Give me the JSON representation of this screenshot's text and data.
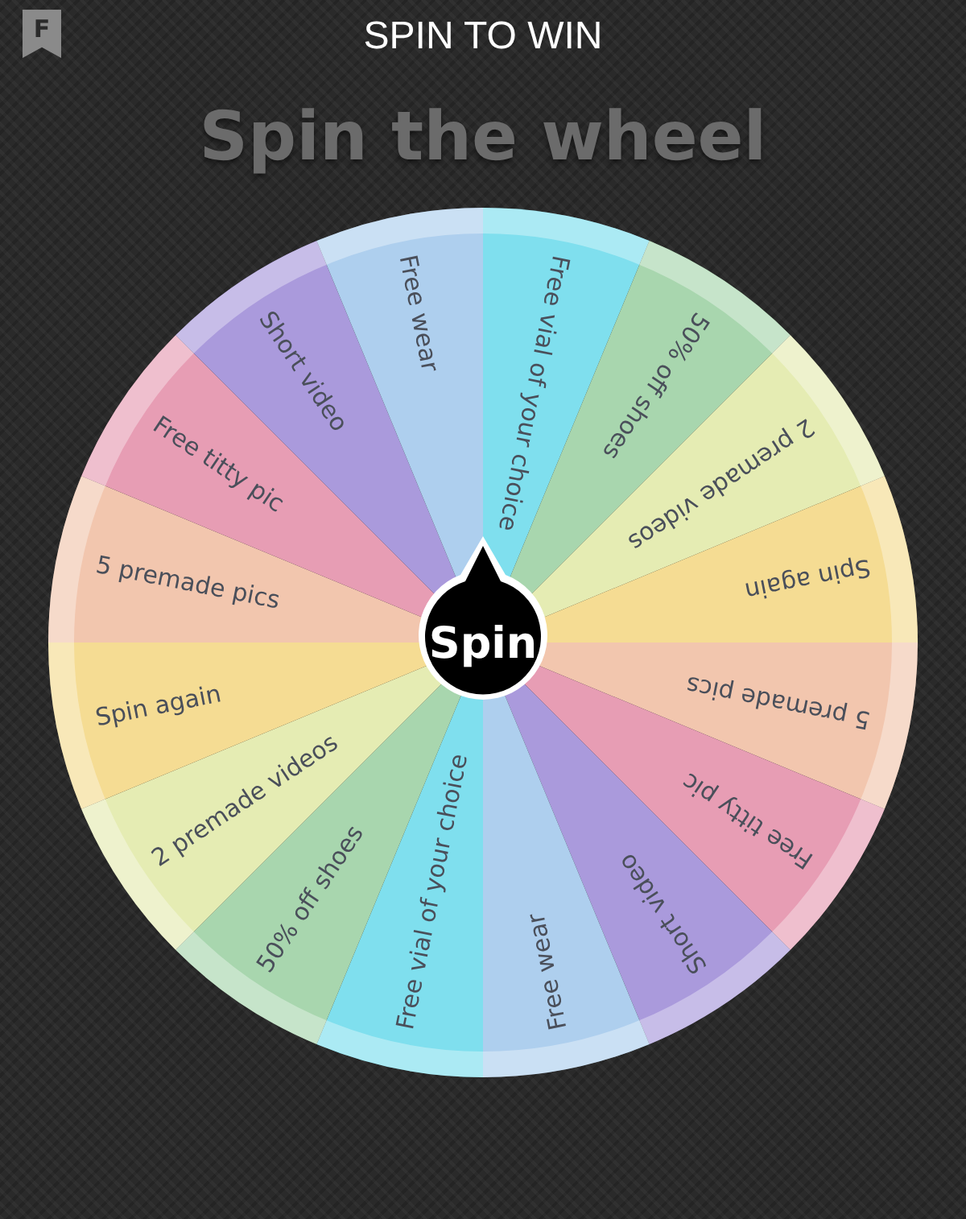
{
  "header": {
    "logo": "F",
    "title": "SPIN TO WIN"
  },
  "heading": "Spin the wheel",
  "wheel": {
    "button": "Spin",
    "segments": [
      {
        "label": "Free vial of your choice",
        "color": "#7fdfee"
      },
      {
        "label": "50% off shoes",
        "color": "#a8d6ae"
      },
      {
        "label": "2 premade videos",
        "color": "#e5ecb3"
      },
      {
        "label": "Spin again",
        "color": "#f5dc93"
      },
      {
        "label": "5 premade pics",
        "color": "#f2c6ae"
      },
      {
        "label": "Free titty pic",
        "color": "#e79db4"
      },
      {
        "label": "Short video",
        "color": "#aa9adc"
      },
      {
        "label": "Free wear",
        "color": "#aecfee"
      },
      {
        "label": "Free vial of your choice",
        "color": "#7fdfee"
      },
      {
        "label": "50% off shoes",
        "color": "#a8d6ae"
      },
      {
        "label": "2 premade videos",
        "color": "#e5ecb3"
      },
      {
        "label": "Spin again",
        "color": "#f5dc93"
      },
      {
        "label": "5 premade pics",
        "color": "#f2c6ae"
      },
      {
        "label": "Free titty pic",
        "color": "#e79db4"
      },
      {
        "label": "Short video",
        "color": "#aa9adc"
      },
      {
        "label": "Free wear",
        "color": "#aecfee"
      }
    ]
  }
}
